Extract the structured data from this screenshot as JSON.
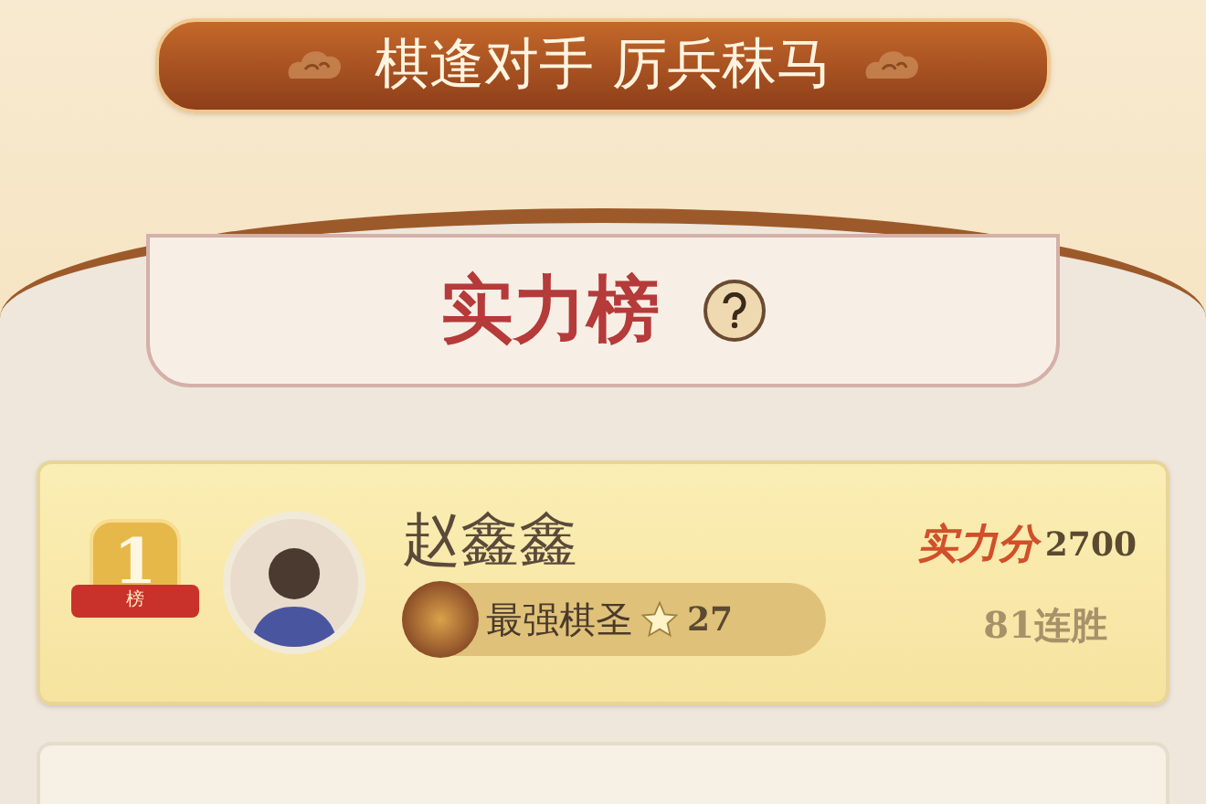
{
  "banner": {
    "text": "棋逢对手 厉兵秣马"
  },
  "board": {
    "title": "实力榜"
  },
  "rows": [
    {
      "rank": "1",
      "rank_label": "榜",
      "name": "赵鑫鑫",
      "title": "最强棋圣",
      "stars": "27",
      "score_label": "实力分",
      "score": "2700",
      "streak": "81连胜"
    }
  ]
}
